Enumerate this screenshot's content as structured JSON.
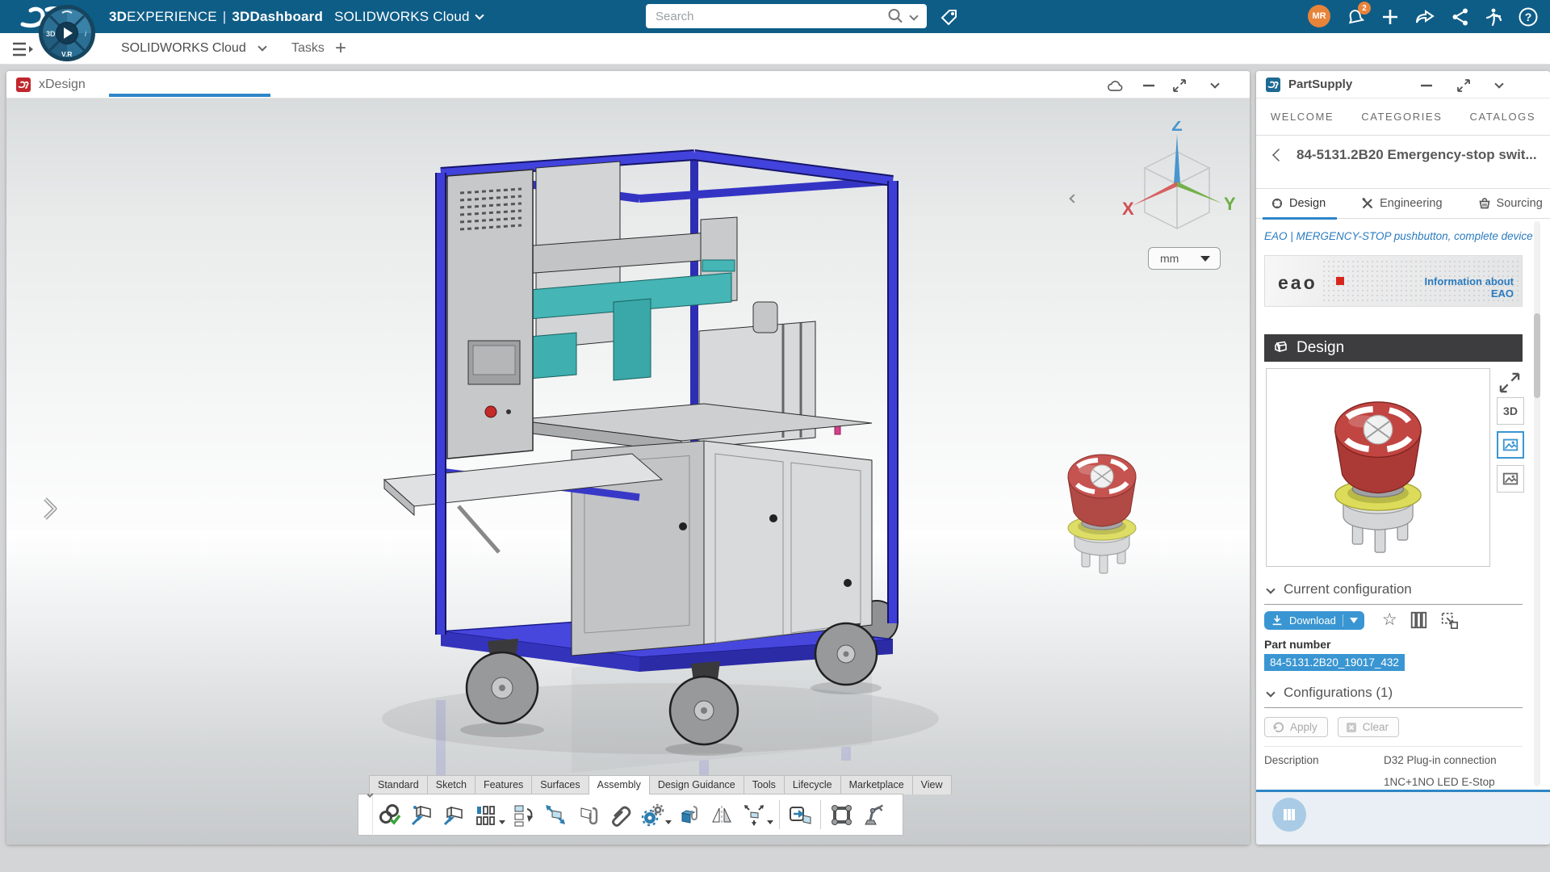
{
  "topbar": {
    "brand_bold": "3D",
    "brand_rest": "EXPERIENCE",
    "brand_sep": "|",
    "brand_app": "3DDashboard",
    "brand_env": "SOLIDWORKS Cloud",
    "search_placeholder": "Search",
    "avatar": "MR",
    "notifications": "2",
    "help_glyph": "?"
  },
  "tabbar": {
    "tab1": "SOLIDWORKS Cloud",
    "tab2": "Tasks",
    "add_label": "+"
  },
  "xdesign": {
    "title": "xDesign",
    "units": "mm",
    "axis_x": "X",
    "axis_y": "Y",
    "axis_z": "Z",
    "toolbar": {
      "tabs": [
        "Standard",
        "Sketch",
        "Features",
        "Surfaces",
        "Assembly",
        "Design Guidance",
        "Tools",
        "Lifecycle",
        "Marketplace",
        "View"
      ],
      "active_tab": "Assembly",
      "icons": [
        "mate",
        "insert-component",
        "component",
        "linear-pattern",
        "assembly-structure",
        "move-component",
        "derive-component",
        "attach",
        "mechanism",
        "fastener",
        "mirror",
        "exploded-view",
        "smart-insert",
        "frame",
        "robot"
      ]
    }
  },
  "partsupply": {
    "title": "PartSupply",
    "nav_tabs": [
      "WELCOME",
      "CATEGORIES",
      "CATALOGS"
    ],
    "part_title": "84-5131.2B20 Emergency-stop swit...",
    "detail_tabs": [
      "Design",
      "Engineering",
      "Sourcing"
    ],
    "supplier_link": "EAO | MERGENCY-STOP pushbutton, complete device",
    "banner_logo": "eao",
    "banner_info_1": "Information about",
    "banner_info_2": "EAO",
    "design_header": "Design",
    "viewer_3d": "3D",
    "current_config_title": "Current configuration",
    "download": "Download",
    "part_number_label": "Part number",
    "part_number_value": "84-5131.2B20_19017_432",
    "configurations_title": "Configurations (1)",
    "apply": "Apply",
    "clear": "Clear",
    "description_label": "Description",
    "description_value_1": "D32 Plug-in connection",
    "description_value_2": "1NC+1NO LED E-Stop"
  },
  "colors": {
    "topbar": "#0E5D87",
    "accent": "#2E86C8",
    "download_button": "#3A96D2",
    "link": "#2B7BBF",
    "frame_blue": "#3C3CCE",
    "teal": "#45B5B5",
    "avatar": "#E8833A",
    "estop_red": "#C14541"
  }
}
